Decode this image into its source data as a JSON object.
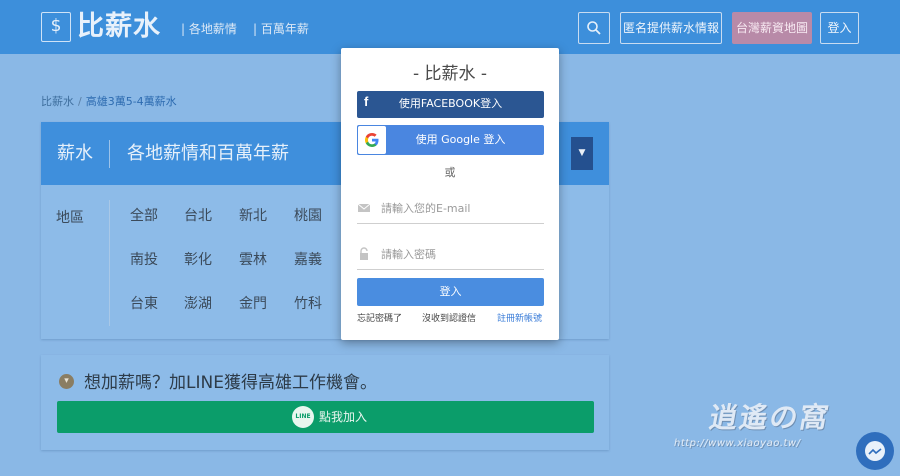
{
  "header": {
    "logo_symbol": "$",
    "logo_text": "比薪水",
    "nav": [
      "| 各地薪情",
      "| 百萬年薪"
    ],
    "search_icon": "search-icon",
    "btn_anon": "匿名提供薪水情報",
    "btn_map": "台灣薪資地圖",
    "btn_login": "登入"
  },
  "breadcrumb": {
    "root": "比薪水",
    "separator": "/",
    "current": "高雄3萬5-4萬薪水"
  },
  "salary_card": {
    "title": "薪水",
    "subtitle": "各地薪情和百萬年薪",
    "region_label": "地區",
    "cities": [
      "全部",
      "台北",
      "新北",
      "桃園",
      "南投",
      "彰化",
      "雲林",
      "嘉義",
      "台東",
      "澎湖",
      "金門",
      "竹科"
    ],
    "dropdown_icon": "caret-down-icon"
  },
  "line_card": {
    "info_icon": "chevron-down-circle-icon",
    "heading": "想加薪嗎？加LINE獲得高雄工作機會。",
    "badge_text": "LINE",
    "button_label": "點我加入"
  },
  "modal": {
    "title": "- 比薪水 -",
    "facebook_icon": "f",
    "facebook_label": "使用FACEBOOK登入",
    "google_label": "使用 Google 登入",
    "or_text": "或",
    "email_placeholder": "請輸入您的E-mail",
    "password_placeholder": "請輸入密碼",
    "login_label": "登入",
    "forgot_password": "忘記密碼了",
    "no_verification": "沒收到認證信",
    "register": "註冊新帳號"
  },
  "watermark": {
    "logo_text": "逍遙の窩",
    "url": "http://www.xiaoyao.tw/"
  },
  "colors": {
    "header_bg": "#3d8fdb",
    "overlay_bg": "#8ab8e6",
    "facebook": "#2b5692",
    "google": "#4a86e0",
    "line_green": "#0b9d6a",
    "map_button": "#b88aa8"
  }
}
